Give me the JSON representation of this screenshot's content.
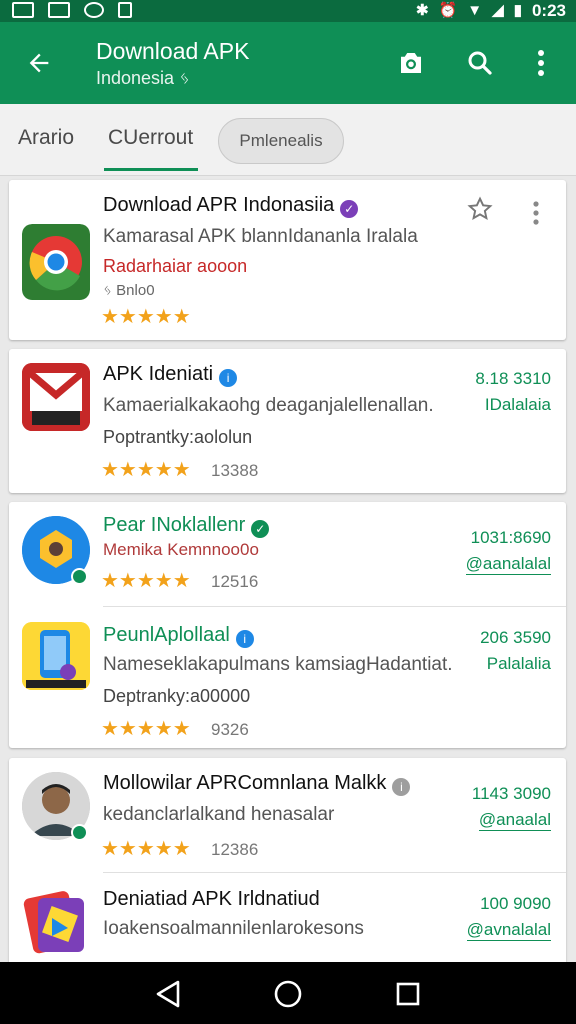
{
  "status_bar": {
    "time": "0:23"
  },
  "app_bar": {
    "title": "Download APK",
    "subtitle": "Indonesia ᛃ"
  },
  "tabs": [
    {
      "label": "Arario"
    },
    {
      "label": "CUerrout"
    }
  ],
  "chip": {
    "label": "Pmlenealis"
  },
  "colors": {
    "primary": "#0f8f56",
    "status": "#0b6b3f",
    "star": "#f2a21b",
    "dev_red": "#c62828"
  },
  "apps": [
    {
      "name": "Download APR Indonasiia",
      "desc": "Kamarasal APK blannIdananla Iralala",
      "dev": "Radarhaiar aooon",
      "extra": "ᛃ Bnlo0",
      "price": "",
      "price2": "",
      "count": ""
    },
    {
      "name": "APK Ideniati",
      "desc": "Kamaerialkakaohg deaganjalellenallan.",
      "dev": "Poptrantky:aololun",
      "price": "8.18 3310",
      "price2": "IDalalaia",
      "count": "13388"
    },
    {
      "name": "Pear INoklallenr",
      "desc": "Memika Kemnnoo0o",
      "dev": "",
      "price": "1031:8690",
      "price2": "@aanalalal",
      "count": "12516"
    },
    {
      "name": "PeunlAplollaal",
      "desc": "Nameseklakapulmans kamsiagHadantiat.",
      "dev": "Deptranky:a00000",
      "price": "206 3590",
      "price2": "Palalalia",
      "count": "9326"
    },
    {
      "name": "Mollowilar APRComnlana Malkk",
      "desc": "kedanclarlalkand henasalar",
      "dev": "",
      "price": "1143 3090",
      "price2": "@anaalal",
      "count": "12386"
    },
    {
      "name": "Deniatiad APK Irldnatiud",
      "desc": "Ioakensoalmannilenlarokesons",
      "dev": "",
      "price": "100 9090",
      "price2": "@avnalalal",
      "count": ""
    }
  ]
}
